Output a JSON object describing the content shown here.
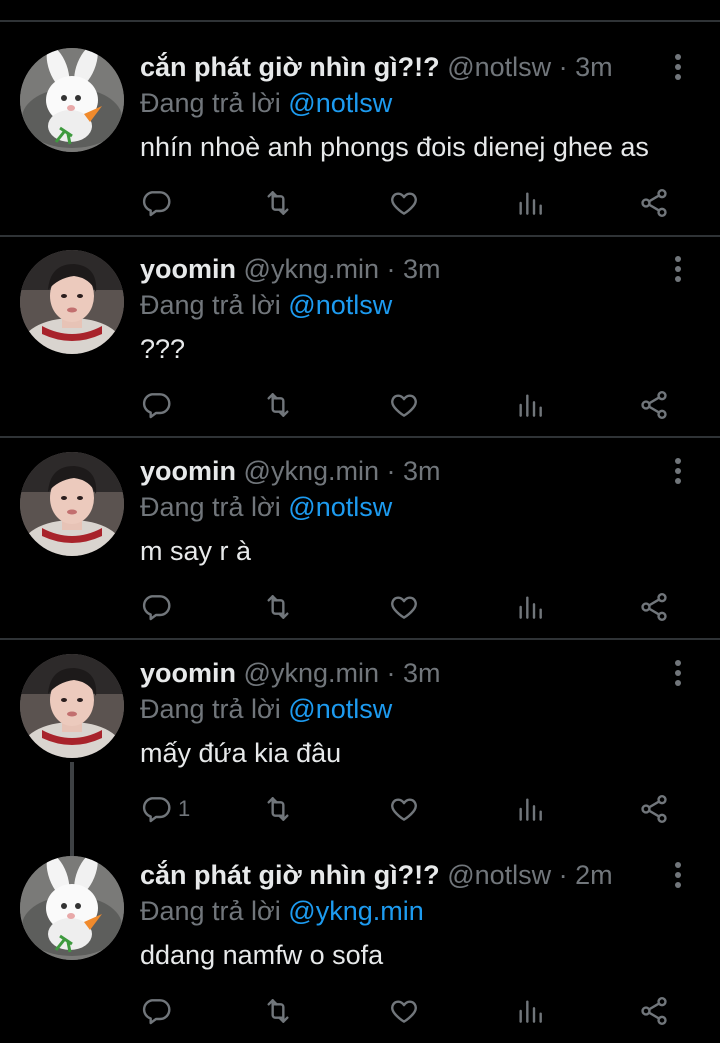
{
  "tweets": [
    {
      "name": "cắn phát giờ nhìn gì?!?",
      "handle": "@notlsw",
      "time": "3m",
      "reply_prefix": "Đang trả lời",
      "reply_to": "@notlsw",
      "text": "nhín nhoè anh phongs đois dienej ghee as",
      "avatar": "bunny-avatar",
      "reply_count": ""
    },
    {
      "name": "yoomin",
      "handle": "@ykng.min",
      "time": "3m",
      "reply_prefix": "Đang trả lời",
      "reply_to": "@notlsw",
      "text": "???",
      "avatar": "person-avatar",
      "reply_count": ""
    },
    {
      "name": "yoomin",
      "handle": "@ykng.min",
      "time": "3m",
      "reply_prefix": "Đang trả lời",
      "reply_to": "@notlsw",
      "text": "m say r à",
      "avatar": "person-avatar",
      "reply_count": ""
    },
    {
      "name": "yoomin",
      "handle": "@ykng.min",
      "time": "3m",
      "reply_prefix": "Đang trả lời",
      "reply_to": "@notlsw",
      "text": "mấy đứa kia đâu",
      "avatar": "person-avatar",
      "reply_count": "1"
    },
    {
      "name": "cắn phát giờ nhìn gì?!?",
      "handle": "@notlsw",
      "time": "2m",
      "reply_prefix": "Đang trả lời",
      "reply_to": "@ykng.min",
      "text": "ddang namfw o sofa",
      "avatar": "bunny-avatar",
      "reply_count": ""
    }
  ],
  "separator": " · ",
  "colors": {
    "background": "#000000",
    "text": "#e7e9ea",
    "muted": "#71767b",
    "link": "#1d9bf0",
    "divider": "#2f3336"
  },
  "icons": [
    "reply-icon",
    "retweet-icon",
    "like-icon",
    "analytics-icon",
    "share-icon",
    "more-icon"
  ]
}
